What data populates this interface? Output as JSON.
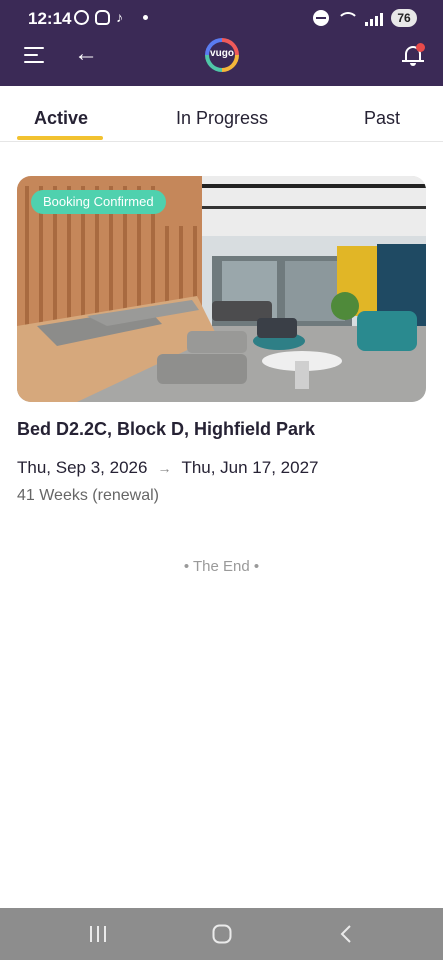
{
  "status_bar": {
    "time": "12:14",
    "battery": "76"
  },
  "app": {
    "logo_text": "vugo"
  },
  "tabs": [
    {
      "label": "Active",
      "active": true
    },
    {
      "label": "In Progress",
      "active": false
    },
    {
      "label": "Past",
      "active": false
    }
  ],
  "booking": {
    "status_badge": "Booking Confirmed",
    "title": "Bed D2.2C, Block D, Highfield Park",
    "start_date": "Thu, Sep 3, 2026",
    "end_date": "Thu, Jun 17, 2027",
    "duration": "41 Weeks (renewal)"
  },
  "list_end_text": "• The End •",
  "colors": {
    "header_bg": "#3b2a56",
    "tab_indicator": "#f2c230",
    "badge_bg": "#4fd1ae",
    "notification_dot": "#e84a4a"
  },
  "icons": {
    "menu": "menu-icon",
    "back": "back-arrow-icon",
    "notifications": "bell-icon",
    "date_arrow": "arrow-right-icon"
  }
}
